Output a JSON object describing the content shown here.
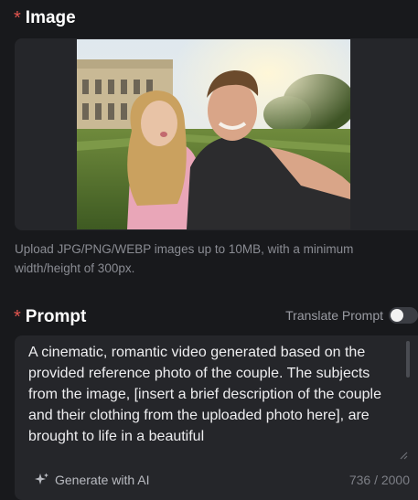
{
  "image_section": {
    "label": "Image",
    "required_mark": "*",
    "help_text": "Upload JPG/PNG/WEBP images up to 10MB, with a minimum width/height of 300px."
  },
  "prompt_section": {
    "label": "Prompt",
    "required_mark": "*",
    "translate_label": "Translate Prompt",
    "translate_enabled": false,
    "text": "A cinematic, romantic video generated based on the provided reference photo of the couple. The subjects from the image, [insert a brief description of the couple and their clothing from the uploaded photo here], are brought to life in a beautiful",
    "generate_label": "Generate with AI",
    "generate_icon": "sparkle-icon",
    "char_count": "736 / 2000"
  },
  "colors": {
    "background": "#18191c",
    "panel": "#25262a",
    "required": "#e3554f"
  }
}
